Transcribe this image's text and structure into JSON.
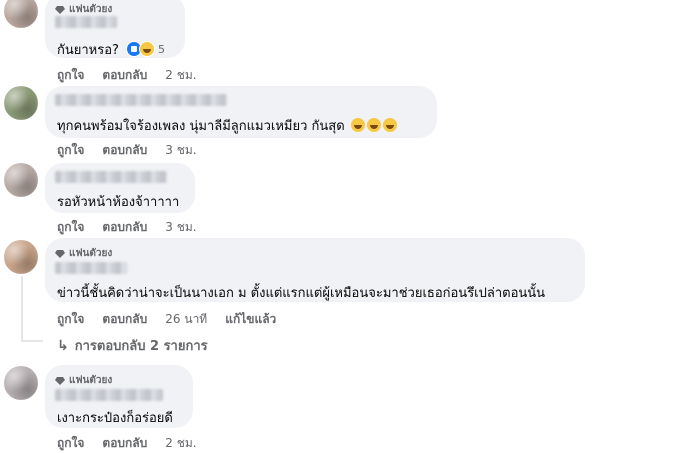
{
  "fan_badge": "แฟนตัวยง",
  "actions": {
    "like": "ถูกใจ",
    "reply": "ตอบกลับ",
    "edited": "แก้ไขแล้ว"
  },
  "comments": [
    {
      "text": "กันยาหรอ?",
      "time": "2 ชม.",
      "reaction_count": "5"
    },
    {
      "text": "ทุกคนพร้อมใจร้องเพลง นุ่มาลีมีลูกแมวเหมียว กันสุด",
      "time": "3 ชม."
    },
    {
      "text": "รอหัวหน้าห้องจ้าาาาา",
      "time": "3 ชม."
    },
    {
      "text": "ข่าวนี้ชั้นคิดว่าน่าจะเป็นนางเอก ม ตั้งแต่แรกแต่ผู้เหมือนจะมาช่วยเธอก่อนรึเปล่าตอนนั้น",
      "time": "26 นาที"
    },
    {
      "text": "เงาะกระป๋องก็อร่อยดี",
      "time": "2 ชม."
    }
  ],
  "replies_link": "การตอบกลับ 2 รายการ",
  "colors": {
    "bubble": "#f0f2f5",
    "meta": "#65676b",
    "text": "#050505",
    "like_blue": "#1877f2"
  }
}
